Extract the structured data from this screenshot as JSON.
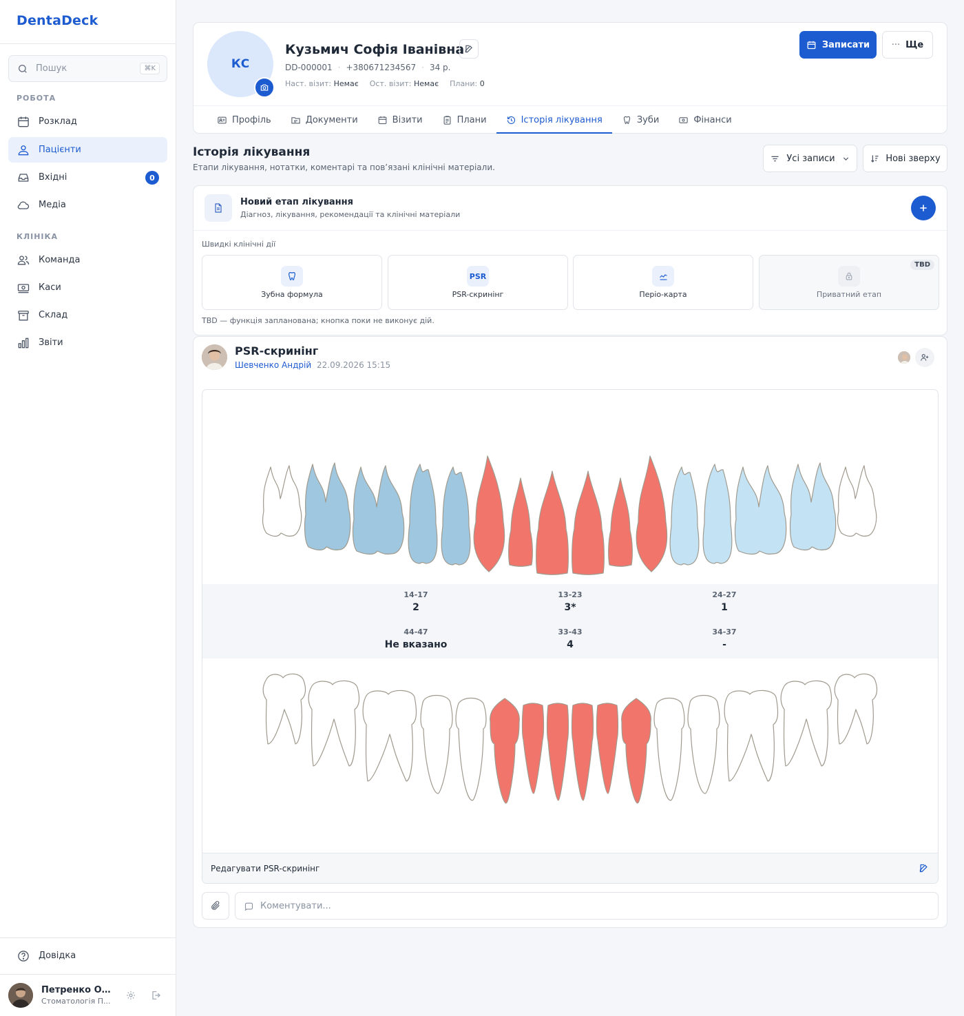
{
  "app": {
    "name": "DentaDeck"
  },
  "search": {
    "placeholder": "Пошук",
    "shortcut": "⌘K"
  },
  "sidebar": {
    "sections": [
      {
        "label": "РОБОТА"
      },
      {
        "label": "КЛІНІКА"
      }
    ],
    "items": [
      {
        "label": "Розклад",
        "icon": "calendar-icon"
      },
      {
        "label": "Пацієнти",
        "icon": "users-icon",
        "active": true
      },
      {
        "label": "Вхідні",
        "icon": "inbox-icon",
        "badge": "0"
      },
      {
        "label": "Медіа",
        "icon": "cloud-icon"
      },
      {
        "label": "Команда",
        "icon": "team-icon"
      },
      {
        "label": "Каси",
        "icon": "cash-register-icon"
      },
      {
        "label": "Склад",
        "icon": "archive-icon"
      },
      {
        "label": "Звіти",
        "icon": "bar-chart-icon"
      }
    ],
    "help": "Довідка",
    "user": {
      "name": "Петренко Ол...",
      "clinic": "Стоматологія П..."
    }
  },
  "patient": {
    "initials": "КС",
    "name": "Кузьмич Софія Іванівна",
    "id": "DD-000001",
    "phone": "+380671234567",
    "age": "34 р.",
    "next_visit_label": "Наст. візит:",
    "next_visit": "Немає",
    "last_visit_label": "Ост. візит:",
    "last_visit": "Немає",
    "plans_label": "Плани:",
    "plans": "0",
    "book_label": "Записати",
    "more_label": "Ще"
  },
  "tabs": [
    {
      "label": "Профіль"
    },
    {
      "label": "Документи"
    },
    {
      "label": "Візити"
    },
    {
      "label": "Плани"
    },
    {
      "label": "Історія лікування",
      "active": true
    },
    {
      "label": "Зуби"
    },
    {
      "label": "Фінанси"
    }
  ],
  "history": {
    "title": "Історія лікування",
    "subtitle": "Етапи лікування, нотатки, коментарі та пов’язані клінічні матеріали.",
    "filter_label": "Усі записи",
    "sort_label": "Нові зверху"
  },
  "new_stage": {
    "title": "Новий етап лікування",
    "subtitle": "Діагноз, лікування, рекомендації та клінічні матеріали",
    "quick_label": "Швидкі клінічні дії",
    "actions": [
      {
        "label": "Зубна формула",
        "icon": "tooth-icon"
      },
      {
        "label": "PSR-скринінг",
        "icon_text": "PSR"
      },
      {
        "label": "Періо-карта",
        "icon": "perio-chart-icon"
      },
      {
        "label": "Приватний етап",
        "icon": "lock-icon",
        "badge": "TBD",
        "disabled": true
      }
    ],
    "tbd_note": "TBD — функція запланована; кнопка поки не виконує дій."
  },
  "entry": {
    "title": "PSR-скринінг",
    "author": "Шевченко Андрій",
    "datetime": "22.09.2026 15:15",
    "sextants": [
      {
        "label": "14-17",
        "value": "2"
      },
      {
        "label": "13-23",
        "value": "3*"
      },
      {
        "label": "24-27",
        "value": "1"
      },
      {
        "label": "44-47",
        "value": "Не вказано"
      },
      {
        "label": "33-43",
        "value": "4"
      },
      {
        "label": "34-37",
        "value": "-"
      }
    ],
    "edit_label": "Редагувати PSR-скринінг",
    "comment_placeholder": "Коментувати..."
  },
  "colors": {
    "accent": "#1d5bd1",
    "psr_code_1": "#c3e3f5",
    "psr_code_2": "#9fc8e0",
    "psr_code_3_4": "#f1756b",
    "psr_none": "#ffffff"
  }
}
